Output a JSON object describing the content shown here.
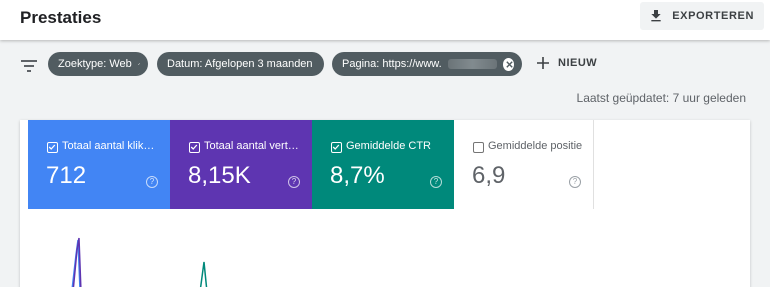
{
  "header": {
    "title": "Prestaties",
    "export_label": "EXPORTEREN"
  },
  "filters": {
    "chips": [
      {
        "label": "Zoektype: Web"
      },
      {
        "label": "Datum: Afgelopen 3 maanden"
      },
      {
        "label": "Pagina: https://www."
      }
    ],
    "new_label": "NIEUW",
    "updated_text": "Laatst geüpdatet: 7 uur geleden"
  },
  "metrics": [
    {
      "label": "Totaal aantal klik…",
      "value": "712",
      "checked": true,
      "color": "#4285f4"
    },
    {
      "label": "Totaal aantal vert…",
      "value": "8,15K",
      "checked": true,
      "color": "#5e35b1"
    },
    {
      "label": "Gemiddelde CTR",
      "value": "8,7%",
      "checked": true,
      "color": "#00897b"
    },
    {
      "label": "Gemiddelde positie",
      "value": "6,9",
      "checked": false,
      "color": "#ffffff"
    }
  ],
  "help_glyph": "?"
}
